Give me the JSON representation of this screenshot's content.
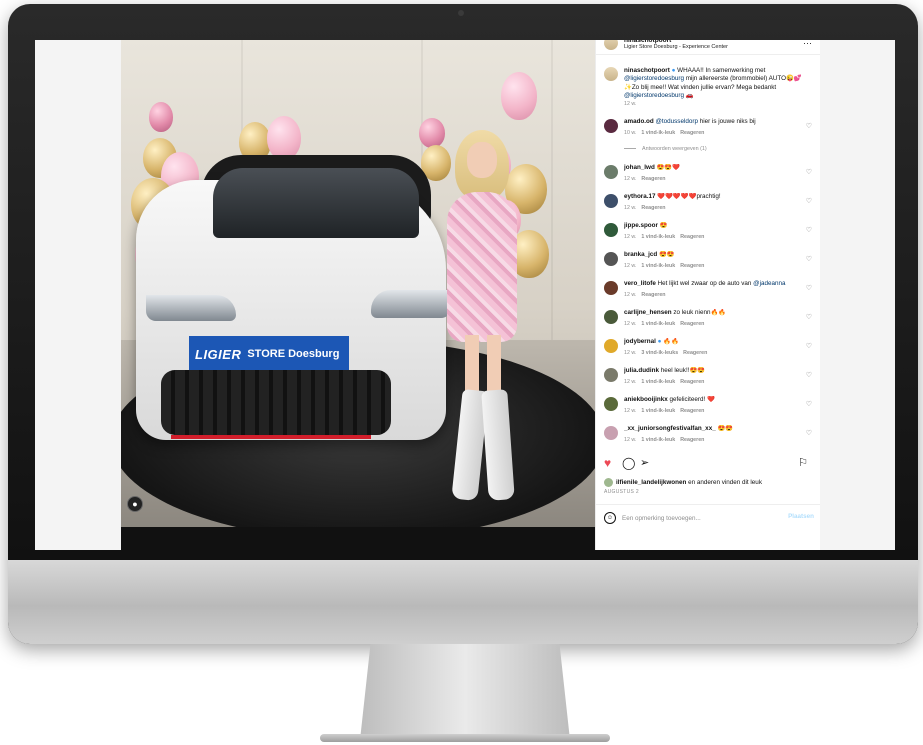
{
  "post": {
    "author": "ninaschotpoort",
    "location": "Ligier Store Doesburg - Experience Center",
    "caption_prefix": "WHAAA!! In samenwerking met",
    "caption_mention1": "@ligierstoredoesburg",
    "caption_mid": "mijn allereerste (brommobiel) AUTO😜💕 ✨Zo blij mee!! Wat vinden jullie ervan? Mega bedankt",
    "caption_mention2": "@ligierstoredoesburg",
    "caption_suffix": "🚗",
    "time": "12 w."
  },
  "image": {
    "plate_brand": "LIGIER",
    "plate_text": "STORE Doesburg"
  },
  "comments": [
    {
      "user": "amado.od",
      "pre": "",
      "mention": "@todusseldorp",
      "text": " hier is jouwe niks bij",
      "time": "10 w.",
      "likes": "1 vind-ik-leuk",
      "reply": "Reageren"
    },
    {
      "user": "johan_lwd",
      "pre": "",
      "mention": "",
      "text": " 😍😍❤️",
      "time": "12 w.",
      "likes": "",
      "reply": "Reageren"
    },
    {
      "user": "eythora.17",
      "pre": "",
      "mention": "",
      "text": " ❤️❤️❤️❤️❤️prachtig!",
      "time": "12 w.",
      "likes": "",
      "reply": "Reageren"
    },
    {
      "user": "jippe.spoor",
      "pre": "",
      "mention": "",
      "text": " 😍",
      "time": "12 w.",
      "likes": "1 vind-ik-leuk",
      "reply": "Reageren"
    },
    {
      "user": "branka_jcd",
      "pre": "",
      "mention": "",
      "text": " 😍😍",
      "time": "12 w.",
      "likes": "1 vind-ik-leuk",
      "reply": "Reageren"
    },
    {
      "user": "vero_litofe",
      "pre": "",
      "mention": "@jadeanna",
      "text": " Het lijkt wel zwaar op de auto van ",
      "time": "12 w.",
      "likes": "",
      "reply": "Reageren"
    },
    {
      "user": "carlijne_hensen",
      "pre": "",
      "mention": "",
      "text": " zo leuk nienn🔥🔥",
      "time": "12 w.",
      "likes": "1 vind-ik-leuk",
      "reply": "Reageren"
    },
    {
      "user": "jodybernal",
      "pre": "",
      "mention": "",
      "text": " 🔥🔥",
      "time": "12 w.",
      "likes": "3 vind-ik-leuks",
      "reply": "Reageren"
    },
    {
      "user": "julia.dudink",
      "pre": "",
      "mention": "",
      "text": " heel leuk!!😍😍",
      "time": "12 w.",
      "likes": "1 vind-ik-leuk",
      "reply": "Reageren"
    },
    {
      "user": "aniekbooijinkx",
      "pre": "",
      "mention": "",
      "text": " gefeliciteerd! ❤️",
      "time": "12 w.",
      "likes": "1 vind-ik-leuk",
      "reply": "Reageren"
    },
    {
      "user": "_xx_juniorsongfestivalfan_xx_",
      "pre": "",
      "mention": "",
      "text": " 😍😍",
      "time": "12 w.",
      "likes": "1 vind-ik-leuk",
      "reply": "Reageren"
    }
  ],
  "replies_label": "Antwoorden weergeven (1)",
  "likes_summary": {
    "user": "ilfienile_landelijkwonen",
    "rest": " en anderen vinden dit leuk"
  },
  "date": "AUGUSTUS 2",
  "add_comment": {
    "placeholder": "Een opmerking toevoegen...",
    "post_label": "Plaatsen"
  },
  "icons": {
    "heart": "heart-filled-icon",
    "comment": "comment-bubble-icon",
    "share": "paper-plane-icon",
    "save": "bookmark-icon",
    "emoji": "smiley-icon",
    "more": "more-dots-icon"
  },
  "colors": {
    "like": "#ed4956",
    "mention": "#00376b",
    "muted": "#8e8e8e",
    "post_disabled": "#b2dffc",
    "plate": "#1c57b5"
  }
}
